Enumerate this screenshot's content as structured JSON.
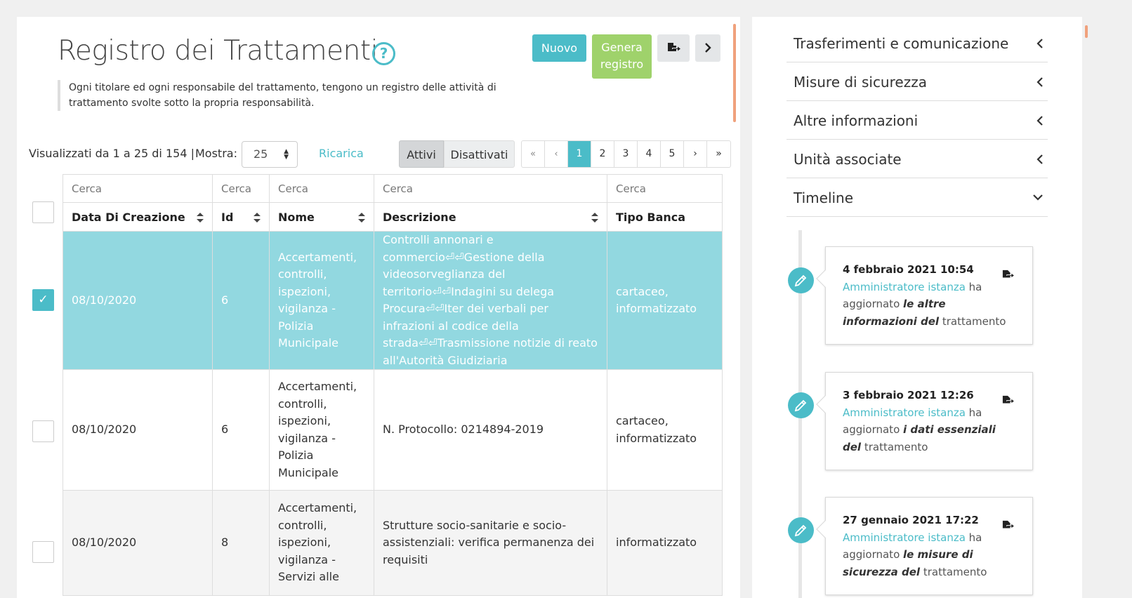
{
  "header": {
    "title": "Registro dei Trattamenti",
    "help_symbol": "?",
    "description": "Ogni titolare ed ogni responsabile del trattamento, tengono un registro delle attività di trattamento svolte sotto la propria responsabilità.",
    "btn_nuovo": "Nuovo",
    "btn_genera_line1": "Genera",
    "btn_genera_line2": "registro"
  },
  "toolbar": {
    "info": "Visualizzati da 1 a 25 di 154 |",
    "mostra_label": "Mostra:",
    "mostra_value": "25",
    "ricarica": "Ricarica",
    "attivi": "Attivi",
    "disattivati": "Disattivati"
  },
  "pager": {
    "first": "«",
    "prev": "‹",
    "pages": [
      "1",
      "2",
      "3",
      "4",
      "5"
    ],
    "next": "›",
    "last": "»"
  },
  "table": {
    "search_placeholder": "Cerca",
    "columns": [
      "Data Di Creazione",
      "Id",
      "Nome",
      "Descrizione",
      "Tipo Banca"
    ],
    "rows": [
      {
        "data": "08/10/2020",
        "id": "6",
        "nome": "Accertamenti, controlli, ispezioni, vigilanza - Polizia Municipale",
        "descrizione": "Controlli annonari e commercio⏎⏎Gestione della videosorveglianza del territorio⏎⏎Indagini su delega Procura⏎⏎Iter dei verbali per infrazioni al codice della strada⏎⏎Trasmissione notizie di reato all'Autorità Giudiziaria",
        "tipo": "cartaceo, informatizzato",
        "selected": true
      },
      {
        "data": "08/10/2020",
        "id": "6",
        "nome": "Accertamenti, controlli, ispezioni, vigilanza - Polizia Municipale",
        "descrizione": "N. Protocollo: 0214894-2019",
        "tipo": "cartaceo, informatizzato",
        "selected": false
      },
      {
        "data": "08/10/2020",
        "id": "8",
        "nome": "Accertamenti, controlli, ispezioni, vigilanza - Servizi alle",
        "descrizione": "Strutture socio-sanitarie e socio-assistenziali: verifica permanenza dei requisiti",
        "tipo": "informatizzato",
        "selected": false
      }
    ]
  },
  "sidebar": {
    "sections": [
      "Trasferimenti e comunicazione",
      "Misure di sicurezza",
      "Altre informazioni",
      "Unità associate",
      "Timeline"
    ]
  },
  "timeline": [
    {
      "date": "4 febbraio 2021 10:54",
      "who": "Amministratore istanza",
      "verb": " ha aggiornato ",
      "what": "le altre informazioni del",
      "tail": " trattamento"
    },
    {
      "date": "3 febbraio 2021 12:26",
      "who": "Amministratore istanza",
      "verb": " ha aggiornato ",
      "what": "i dati essenziali del",
      "tail": " trattamento"
    },
    {
      "date": "27 gennaio 2021 17:22",
      "who": "Amministratore istanza",
      "verb": " ha aggiornato ",
      "what": "le misure di sicurezza del",
      "tail": " trattamento"
    }
  ],
  "colors": {
    "accent": "#4bbcc8",
    "green": "#9fd26b",
    "selected_row": "#92d8e0",
    "orange_scroll": "#f0a17c"
  },
  "icons": {
    "help": "question-circle-icon",
    "export": "file-export-icon",
    "next": "chevron-right-icon",
    "accordion_collapsed": "chevron-left-icon",
    "accordion_expanded": "chevron-down-icon",
    "timeline": "pencil-icon",
    "sort": "sort-icon",
    "select_arrows": "select-arrows-icon",
    "check": "checkmark-icon"
  }
}
